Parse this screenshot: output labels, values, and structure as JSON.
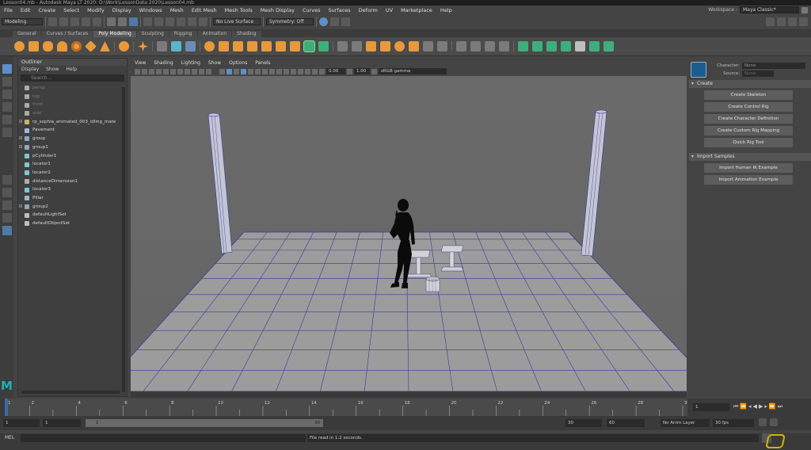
{
  "window": {
    "title": "Lesson04.mb - Autodesk Maya LT 2020: D:\\Work\\LessonData 2020\\Lesson04.mb"
  },
  "menus": [
    "File",
    "Edit",
    "Create",
    "Select",
    "Modify",
    "Display",
    "Windows",
    "Mesh",
    "Edit Mesh",
    "Mesh Tools",
    "Mesh Display",
    "Curves",
    "Surfaces",
    "Deform",
    "UV",
    "Marketplace",
    "Help"
  ],
  "workspace": {
    "label": "Workspace :",
    "value": "Maya Classic*"
  },
  "status_line": {
    "mode": "Modeling",
    "live_surface": "No Live Surface",
    "symmetry": "Symmetry: Off"
  },
  "shelf_tabs": [
    "General",
    "Curves / Surfaces",
    "Poly Modeling",
    "Sculpting",
    "Rigging",
    "Animation",
    "Shading"
  ],
  "shelf_active_tab": "Poly Modeling",
  "outliner": {
    "title": "Outliner",
    "menu": [
      "Display",
      "Show",
      "Help"
    ],
    "search_placeholder": "Search...",
    "items": [
      {
        "label": "persp",
        "icon": "camera-icon",
        "dim": true
      },
      {
        "label": "top",
        "icon": "camera-icon",
        "dim": true
      },
      {
        "label": "front",
        "icon": "camera-icon",
        "dim": true
      },
      {
        "label": "side",
        "icon": "camera-icon",
        "dim": true
      },
      {
        "label": "rp_sophia_animated_003_idling_mate",
        "icon": "joint-icon",
        "expand": true
      },
      {
        "label": "Pavement",
        "icon": "transform-icon"
      },
      {
        "label": "group",
        "icon": "group-icon",
        "expand": true
      },
      {
        "label": "group1",
        "icon": "group-icon",
        "expand": true
      },
      {
        "label": "pCylinder1",
        "icon": "mesh-icon"
      },
      {
        "label": "locator1",
        "icon": "locator-icon"
      },
      {
        "label": "locator2",
        "icon": "locator-icon"
      },
      {
        "label": "distanceDimension1",
        "icon": "measure-icon"
      },
      {
        "label": "locator3",
        "icon": "locator-icon"
      },
      {
        "label": "Pillar",
        "icon": "transform-icon"
      },
      {
        "label": "group2",
        "icon": "group-icon",
        "expand": true
      },
      {
        "label": "defaultLightSet",
        "icon": "set-icon"
      },
      {
        "label": "defaultObjectSet",
        "icon": "set-icon"
      }
    ]
  },
  "viewport": {
    "menu": [
      "View",
      "Shading",
      "Lighting",
      "Show",
      "Options",
      "Panels"
    ],
    "exposure": "0.00",
    "gamma": "1.00",
    "color_space": "sRGB gamma"
  },
  "hik": {
    "character_label": "Character:",
    "character_value": "None",
    "source_label": "Source:",
    "source_value": "None",
    "sections": [
      {
        "title": "Create",
        "buttons": [
          "Create Skeleton",
          "Create Control Rig",
          "Create Character Definition",
          "Create Custom Rig Mapping",
          "Quick Rig Tool"
        ]
      },
      {
        "title": "Import Samples",
        "buttons": [
          "Import Human IK Example",
          "Import Animation Example"
        ]
      }
    ]
  },
  "time_slider": {
    "ticks": [
      "1",
      "2",
      "4",
      "6",
      "8",
      "10",
      "12",
      "14",
      "16",
      "18",
      "20",
      "22",
      "24",
      "26",
      "28",
      "30"
    ],
    "current_frame": "1"
  },
  "range_slider": {
    "start": "1",
    "start_inner": "1",
    "range_start_label": "1",
    "range_end_label": "30",
    "end": "30",
    "end_total": "60",
    "anim_layer": "No Anim Layer",
    "fps": "30 fps"
  },
  "command_line": {
    "language": "MEL",
    "feedback": "File read in  1.2 seconds."
  },
  "colors": {
    "accent_blue": "#5d8fc8",
    "shelf_orange": "#e8993a",
    "shelf_green": "#3fae7d",
    "grid_blue": "#3a3a9a",
    "maya_logo": "#1ab1b8"
  }
}
